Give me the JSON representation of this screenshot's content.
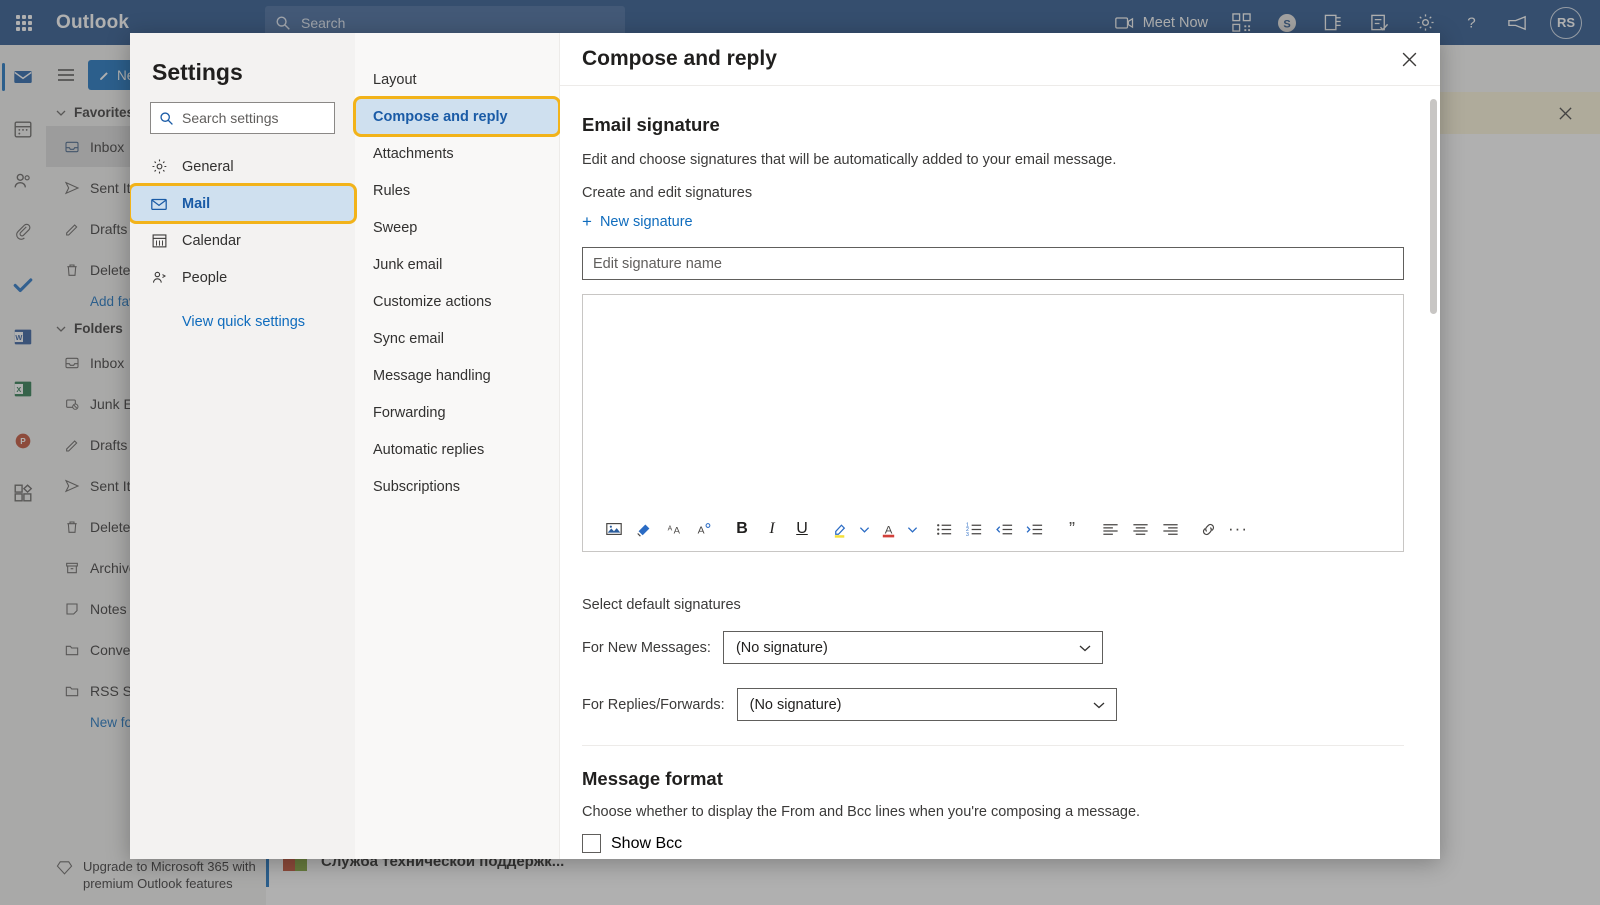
{
  "topbar": {
    "waffle_label": "App launcher",
    "brand": "Outlook",
    "search_placeholder": "Search",
    "meet_now": "Meet Now",
    "avatar_initials": "RS",
    "icons": [
      "waffle-icon",
      "search-icon",
      "video-camera-icon",
      "qr-code-icon",
      "skype-icon",
      "office-icon",
      "todo-icon",
      "gear-icon",
      "help-icon",
      "feedback-icon"
    ]
  },
  "left_rail": {
    "items": [
      {
        "name": "mail",
        "label": "Mail",
        "active": true
      },
      {
        "name": "calendar",
        "label": "Calendar",
        "active": false
      },
      {
        "name": "people",
        "label": "People",
        "active": false
      },
      {
        "name": "files",
        "label": "Files",
        "active": false
      },
      {
        "name": "todo",
        "label": "To Do",
        "active": false
      },
      {
        "name": "word",
        "label": "Word",
        "active": false
      },
      {
        "name": "excel",
        "label": "Excel",
        "active": false
      },
      {
        "name": "powerpoint",
        "label": "PowerPoint",
        "active": false
      },
      {
        "name": "apps",
        "label": "All apps",
        "active": false
      }
    ]
  },
  "folder_pane": {
    "new_message": "New message",
    "favorites_header": "Favorites",
    "favorites": [
      {
        "label": "Inbox",
        "icon": "inbox-icon",
        "selected": true
      },
      {
        "label": "Sent Items",
        "icon": "sent-icon",
        "selected": false
      },
      {
        "label": "Drafts",
        "icon": "drafts-icon",
        "selected": false
      },
      {
        "label": "Deleted Items",
        "icon": "trash-icon",
        "selected": false
      }
    ],
    "add_favorite": "Add favorite",
    "folders_header": "Folders",
    "folders": [
      {
        "label": "Inbox",
        "icon": "inbox-icon"
      },
      {
        "label": "Junk Email",
        "icon": "junk-icon"
      },
      {
        "label": "Drafts",
        "icon": "drafts-icon"
      },
      {
        "label": "Sent Items",
        "icon": "sent-icon"
      },
      {
        "label": "Deleted Items",
        "icon": "trash-icon"
      },
      {
        "label": "Archive",
        "icon": "archive-icon"
      },
      {
        "label": "Notes",
        "icon": "notes-icon"
      },
      {
        "label": "Conversation History",
        "icon": "folder-icon"
      },
      {
        "label": "RSS Subscriptions",
        "icon": "folder-icon"
      }
    ],
    "new_folder": "New folder",
    "upgrade_text": "Upgrade to Microsoft 365 with premium Outlook features"
  },
  "message_list": {
    "items": [
      {
        "subject": "Служба технической поддержк..."
      }
    ]
  },
  "settings_dialog": {
    "title": "Settings",
    "search_placeholder": "Search settings",
    "nav": [
      {
        "label": "General",
        "icon": "gear-icon",
        "selected": false,
        "highlighted": false
      },
      {
        "label": "Mail",
        "icon": "envelope-icon",
        "selected": true,
        "highlighted": true
      },
      {
        "label": "Calendar",
        "icon": "calendar-icon",
        "selected": false,
        "highlighted": false
      },
      {
        "label": "People",
        "icon": "people-icon",
        "selected": false,
        "highlighted": false
      }
    ],
    "quick_settings_link": "View quick settings",
    "subnav": [
      {
        "label": "Layout",
        "selected": false,
        "highlighted": false
      },
      {
        "label": "Compose and reply",
        "selected": true,
        "highlighted": true
      },
      {
        "label": "Attachments",
        "selected": false,
        "highlighted": false
      },
      {
        "label": "Rules",
        "selected": false,
        "highlighted": false
      },
      {
        "label": "Sweep",
        "selected": false,
        "highlighted": false
      },
      {
        "label": "Junk email",
        "selected": false,
        "highlighted": false
      },
      {
        "label": "Customize actions",
        "selected": false,
        "highlighted": false
      },
      {
        "label": "Sync email",
        "selected": false,
        "highlighted": false
      },
      {
        "label": "Message handling",
        "selected": false,
        "highlighted": false
      },
      {
        "label": "Forwarding",
        "selected": false,
        "highlighted": false
      },
      {
        "label": "Automatic replies",
        "selected": false,
        "highlighted": false
      },
      {
        "label": "Subscriptions",
        "selected": false,
        "highlighted": false
      }
    ],
    "panel": {
      "header": "Compose and reply",
      "close_label": "Close",
      "signature_section_title": "Email signature",
      "signature_description": "Edit and choose signatures that will be automatically added to your email message.",
      "create_edit_label": "Create and edit signatures",
      "new_signature_label": "New signature",
      "new_signature_plus": "+",
      "signature_name_placeholder": "Edit signature name",
      "signature_body_value": "",
      "toolbar_icons": [
        "insert-picture-icon",
        "format-painter-icon",
        "font-size-icon",
        "font-style-icon",
        "bold-icon",
        "italic-icon",
        "underline-icon",
        "highlight-icon",
        "highlight-chevron-icon",
        "font-color-icon",
        "font-color-chevron-icon",
        "bulleted-list-icon",
        "numbered-list-icon",
        "decrease-indent-icon",
        "increase-indent-icon",
        "quote-icon",
        "align-left-icon",
        "align-center-icon",
        "align-right-icon",
        "insert-link-icon",
        "more-options-icon"
      ],
      "toolbar_labels": {
        "bold": "B",
        "italic": "I",
        "underline": "U",
        "font_color": "A",
        "font_size": "AA",
        "font_style": "A",
        "quote": "”",
        "more": "···"
      },
      "defaults_label": "Select default signatures",
      "new_messages_label": "For New Messages:",
      "new_messages_value": "(No signature)",
      "replies_label": "For Replies/Forwards:",
      "replies_value": "(No signature)",
      "message_format_title": "Message format",
      "message_format_description": "Choose whether to display the From and Bcc lines when you're composing a message.",
      "show_bcc_label": "Show Bcc"
    }
  },
  "colors": {
    "brand_blue": "#1f4e87",
    "accent_blue": "#0f6cbd",
    "highlight_gold": "#f2b31a",
    "selected_bg": "#cfe0ef",
    "banner_yellow": "#fdf6d9"
  }
}
